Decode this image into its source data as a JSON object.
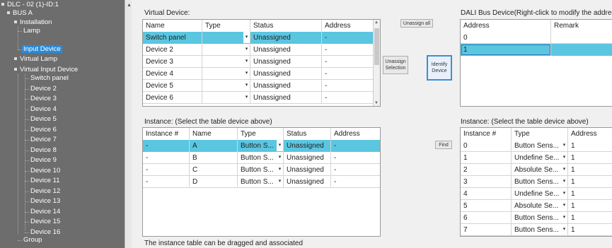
{
  "tree": {
    "root": "DLC - 02 (1)-ID:1",
    "bus": "BUS A",
    "installation": "Installation",
    "lamp": "Lamp",
    "input_device": "Input Device",
    "virtual_lamp": "Virtual Lamp",
    "virtual_input_device": "Virtual Input Device",
    "children": [
      "Switch panel",
      "Device 2",
      "Device 3",
      "Device 4",
      "Device 5",
      "Device 6",
      "Device 7",
      "Device 8",
      "Device 9",
      "Device 10",
      "Device 11",
      "Device 12",
      "Device 13",
      "Device 14",
      "Device 15",
      "Device 16"
    ],
    "group": "Group"
  },
  "virtual_device": {
    "label": "Virtual Device:",
    "columns": [
      "Name",
      "Type",
      "Status",
      "Address"
    ],
    "rows": [
      {
        "name": "Switch panel",
        "type": "",
        "status": "Unassigned",
        "address": "-"
      },
      {
        "name": "Device 2",
        "type": "",
        "status": "Unassigned",
        "address": "-"
      },
      {
        "name": "Device 3",
        "type": "",
        "status": "Unassigned",
        "address": "-"
      },
      {
        "name": "Device 4",
        "type": "",
        "status": "Unassigned",
        "address": "-"
      },
      {
        "name": "Device 5",
        "type": "",
        "status": "Unassigned",
        "address": "-"
      },
      {
        "name": "Device 6",
        "type": "",
        "status": "Unassigned",
        "address": "-"
      }
    ]
  },
  "instance_left": {
    "label": "Instance:  (Select the table device above)",
    "columns": [
      "Instance #",
      "Name",
      "Type",
      "Status",
      "Address"
    ],
    "rows": [
      {
        "instance": "-",
        "name": "A",
        "type": "Button S...",
        "status": "Unassigned",
        "address": "-"
      },
      {
        "instance": "-",
        "name": "B",
        "type": "Button S...",
        "status": "Unassigned",
        "address": "-"
      },
      {
        "instance": "-",
        "name": "C",
        "type": "Button S...",
        "status": "Unassigned",
        "address": "-"
      },
      {
        "instance": "-",
        "name": "D",
        "type": "Button S...",
        "status": "Unassigned",
        "address": "-"
      }
    ],
    "footer": "The instance table can be dragged and associated"
  },
  "buttons": {
    "unassign_all": "Unassign all",
    "unassign_selection": "Unassign Selection",
    "identify_device": "Identify Device",
    "find": "Find"
  },
  "dali_bus": {
    "label": "DALI Bus Device(Right-click to modify the address",
    "columns": [
      "Address",
      "Remark"
    ],
    "rows": [
      {
        "address": "0",
        "remark": ""
      },
      {
        "address": "1",
        "remark": ""
      }
    ]
  },
  "instance_right": {
    "label": "Instance:  (Select the table device above)",
    "columns": [
      "Instance #",
      "Type",
      "Address"
    ],
    "rows": [
      {
        "instance": "0",
        "type": "Button Sens...",
        "address": "1"
      },
      {
        "instance": "1",
        "type": "Undefine Se...",
        "address": "1"
      },
      {
        "instance": "2",
        "type": "Absolute Se...",
        "address": "1"
      },
      {
        "instance": "3",
        "type": "Button Sens...",
        "address": "1"
      },
      {
        "instance": "4",
        "type": "Undefine Se...",
        "address": "1"
      },
      {
        "instance": "5",
        "type": "Absolute Se...",
        "address": "1"
      },
      {
        "instance": "6",
        "type": "Button Sens...",
        "address": "1"
      },
      {
        "instance": "7",
        "type": "Button Sens...",
        "address": "1"
      }
    ]
  },
  "colors": {
    "selection": "#5bc6e0",
    "tree_bg": "#6d6d6d",
    "tree_selected": "#2a8ad8"
  }
}
